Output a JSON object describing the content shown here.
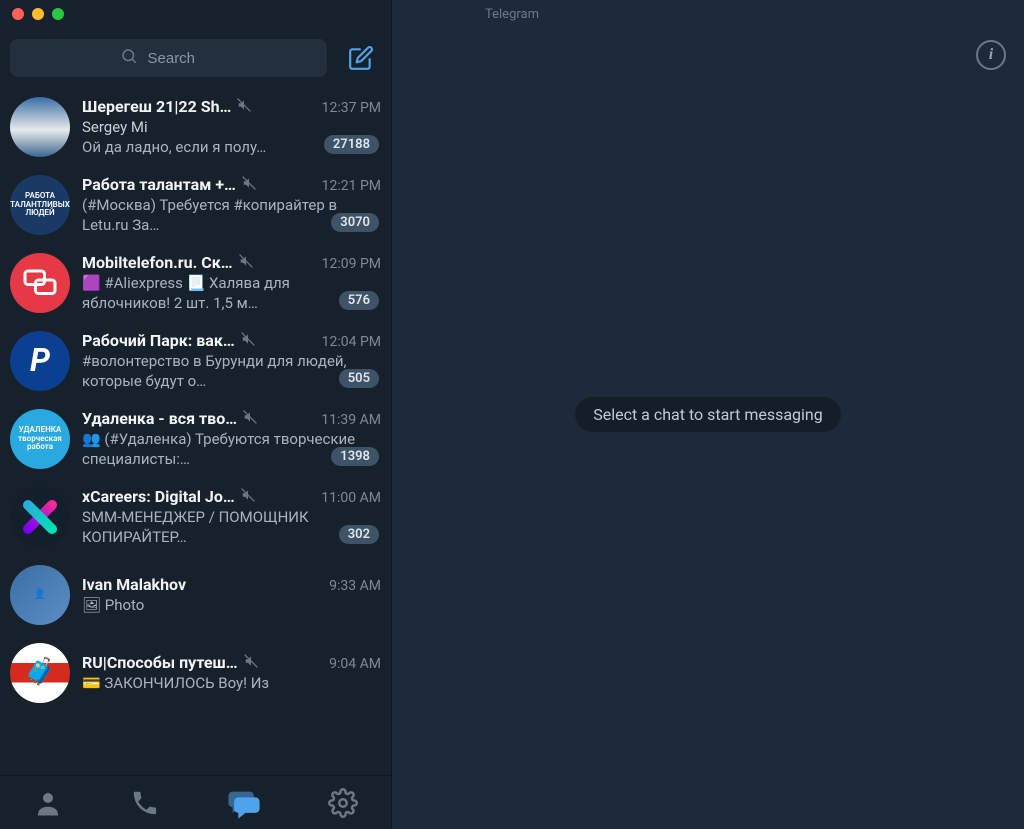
{
  "app": {
    "title": "Telegram"
  },
  "search": {
    "placeholder": "Search"
  },
  "main": {
    "empty_text": "Select a chat to start messaging",
    "info_label": "i"
  },
  "chats": [
    {
      "name": "Шерегеш 21|22 Sh…",
      "muted": true,
      "time": "12:37 PM",
      "sender": "Sergey Mi",
      "preview": "Ой да ладно, если я полу…",
      "badge": "27188"
    },
    {
      "name": "Работа талантам +…",
      "muted": true,
      "time": "12:21 PM",
      "preview": "(#Москва) Требуется #копирайтер в Letu.ru    За…",
      "badge": "3070"
    },
    {
      "name": "Mobiltelefon.ru. Ск…",
      "muted": true,
      "time": "12:09 PM",
      "preview": "🟪 #Aliexpress   📃 Халява для яблочников! 2 шт. 1,5 м…",
      "badge": "576"
    },
    {
      "name": "Рабочий Парк: вак…",
      "muted": true,
      "time": "12:04 PM",
      "preview": "#волонтерство в Бурунди для людей, которые будут о…",
      "badge": "505"
    },
    {
      "name": "Удаленка - вся тво…",
      "muted": true,
      "time": "11:39 AM",
      "preview": "👥 (#Удаленка) Требуются творческие специалисты:…",
      "badge": "1398"
    },
    {
      "name": "xCareers: Digital Jo…",
      "muted": true,
      "time": "11:00 AM",
      "preview": "SMM-МЕНЕДЖЕР / ПОМОЩНИК КОПИРАЙТЕР…",
      "badge": "302"
    },
    {
      "name": "Ivan Malakhov",
      "muted": false,
      "time": "9:33 AM",
      "preview": "🖼 Photo",
      "badge": ""
    },
    {
      "name": "RU|Способы путеш…",
      "muted": true,
      "time": "9:04 AM",
      "preview": "💳 ЗАКОНЧИЛОСЬ   Boy! Из",
      "badge": ""
    }
  ]
}
